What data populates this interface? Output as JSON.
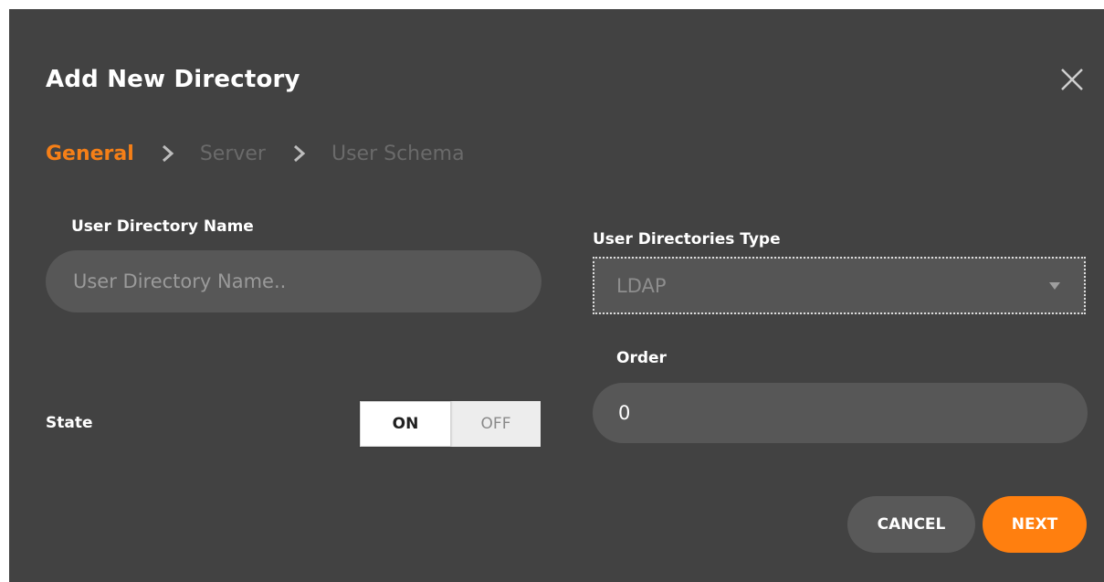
{
  "dialog": {
    "title": "Add New Directory",
    "close_icon": "close-icon"
  },
  "steps": [
    {
      "label": "General",
      "active": true
    },
    {
      "label": "Server",
      "active": false
    },
    {
      "label": "User Schema",
      "active": false
    }
  ],
  "fields": {
    "directory_name": {
      "label": "User Directory Name",
      "placeholder": "User Directory Name..",
      "value": ""
    },
    "directory_type": {
      "label": "User Directories Type",
      "selected": "LDAP"
    },
    "order": {
      "label": "Order",
      "value": "0"
    },
    "state": {
      "label": "State",
      "on_label": "ON",
      "off_label": "OFF",
      "value": "ON"
    }
  },
  "buttons": {
    "cancel_label": "CANCEL",
    "next_label": "NEXT"
  },
  "colors": {
    "accent": "#f57f17",
    "dialog_bg": "#424242",
    "field_bg": "#575757",
    "next_button": "#ff7f0f",
    "cancel_button": "#595959"
  }
}
